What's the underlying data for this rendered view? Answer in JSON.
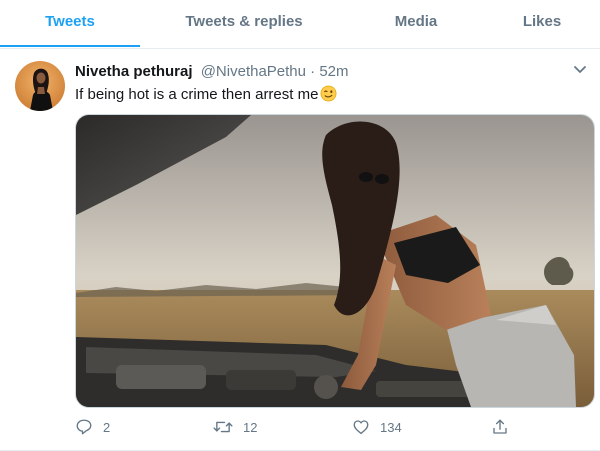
{
  "tabs": [
    {
      "label": "Tweets",
      "active": true
    },
    {
      "label": "Tweets & replies",
      "active": false
    },
    {
      "label": "Media",
      "active": false
    },
    {
      "label": "Likes",
      "active": false
    }
  ],
  "tweet": {
    "author_name": "Nivetha pethuraj",
    "handle": "@NivethaPethu",
    "separator": "·",
    "time": "52m",
    "text": "If being hot is a crime then arrest me",
    "emoji_icon": "winking-face-emoji",
    "more_icon": "chevron-down-icon",
    "media_description_icon": "photo-woman-leaning-over-car-engine"
  },
  "actions": {
    "reply_count": "2",
    "retweet_count": "12",
    "like_count": "134"
  },
  "colors": {
    "accent": "#1da1f2",
    "muted": "#657786",
    "text": "#14171a",
    "border": "#e6ecf0"
  }
}
